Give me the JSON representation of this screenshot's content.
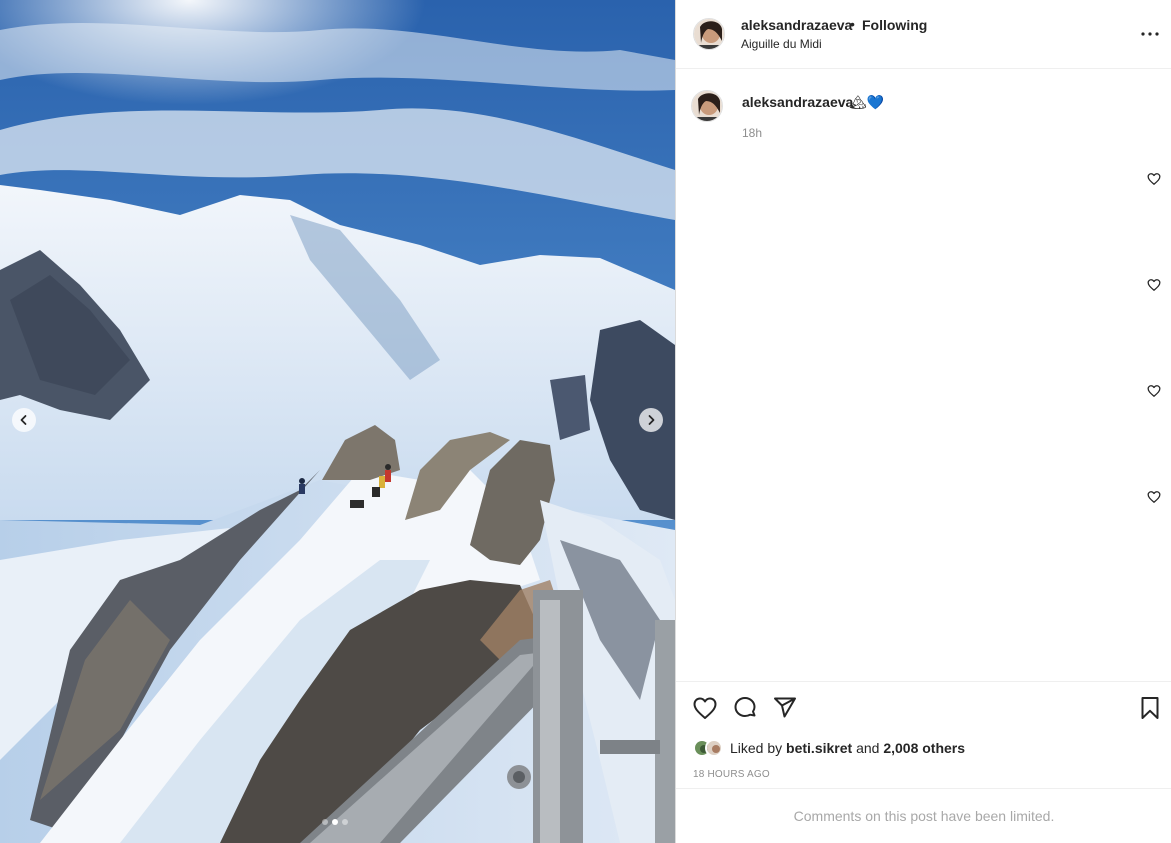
{
  "post": {
    "username": "aleksandrazaeva",
    "separator": "•",
    "follow_status": "Following",
    "location": "Aiguille du Midi",
    "more_icon": "more-horizontal-icon"
  },
  "caption": {
    "username": "aleksandrazaeva",
    "text": "🏔💙",
    "time": "18h"
  },
  "comment_like_icons": [
    "heart-outline-icon",
    "heart-outline-icon",
    "heart-outline-icon",
    "heart-outline-icon"
  ],
  "actions": {
    "like_icon": "heart-outline-icon",
    "comment_icon": "comment-bubble-icon",
    "share_icon": "send-paper-plane-icon",
    "save_icon": "bookmark-icon"
  },
  "likes": {
    "prefix": "Liked by",
    "user": "beti.sikret",
    "conjunction": "and",
    "others": "2,008 others"
  },
  "timestamp": "18 HOURS AGO",
  "comments_notice": "Comments on this post have been limited.",
  "carousel": {
    "total_slides": 3,
    "active_slide": 2
  },
  "colors": {
    "text_primary": "#262626",
    "text_secondary": "#8e8e8e",
    "divider": "#efefef",
    "notice": "#a8a8a8"
  }
}
